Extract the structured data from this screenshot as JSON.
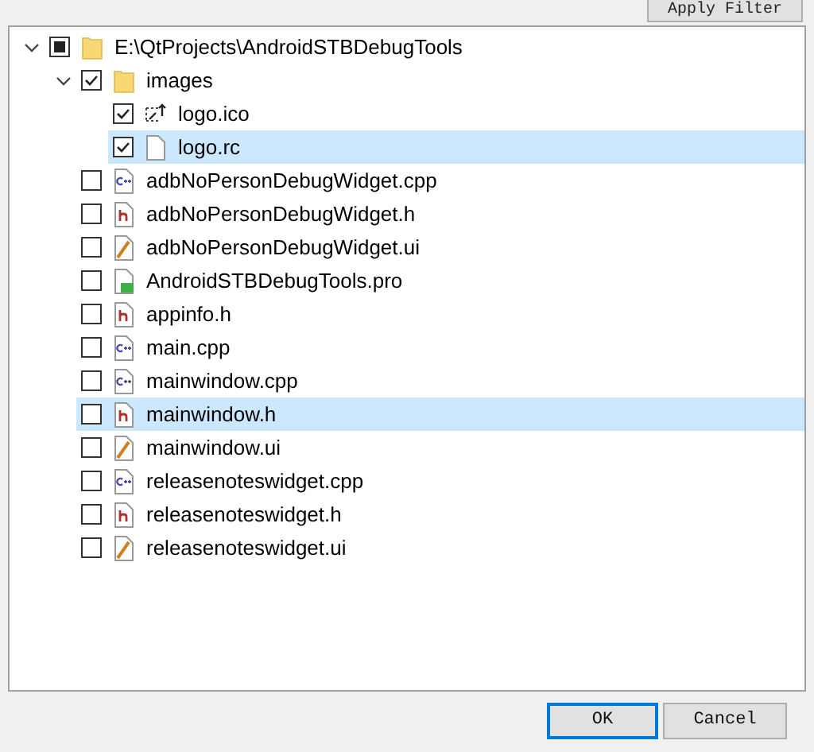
{
  "apply_filter_button": "Apply Filter",
  "tree": [
    {
      "label": "E:\\QtProjects\\AndroidSTBDebugTools",
      "kind": "folder",
      "partial": true,
      "expanded": true,
      "selected": false,
      "children": [
        {
          "label": "images",
          "kind": "folder",
          "checked": true,
          "expanded": true,
          "selected": false,
          "children": [
            {
              "label": "logo.ico",
              "kind": "image",
              "checked": true,
              "selected": false
            },
            {
              "label": "logo.rc",
              "kind": "file",
              "checked": true,
              "selected": true
            }
          ]
        },
        {
          "label": "adbNoPersonDebugWidget.cpp",
          "kind": "cpp",
          "checked": false,
          "selected": false
        },
        {
          "label": "adbNoPersonDebugWidget.h",
          "kind": "h",
          "checked": false,
          "selected": false
        },
        {
          "label": "adbNoPersonDebugWidget.ui",
          "kind": "ui",
          "checked": false,
          "selected": false
        },
        {
          "label": "AndroidSTBDebugTools.pro",
          "kind": "pro",
          "checked": false,
          "selected": false
        },
        {
          "label": "appinfo.h",
          "kind": "h",
          "checked": false,
          "selected": false
        },
        {
          "label": "main.cpp",
          "kind": "cpp",
          "checked": false,
          "selected": false
        },
        {
          "label": "mainwindow.cpp",
          "kind": "cpp",
          "checked": false,
          "selected": false
        },
        {
          "label": "mainwindow.h",
          "kind": "h",
          "checked": false,
          "selected": true
        },
        {
          "label": "mainwindow.ui",
          "kind": "ui",
          "checked": false,
          "selected": false
        },
        {
          "label": "releasenoteswidget.cpp",
          "kind": "cpp",
          "checked": false,
          "selected": false
        },
        {
          "label": "releasenoteswidget.h",
          "kind": "h",
          "checked": false,
          "selected": false
        },
        {
          "label": "releasenoteswidget.ui",
          "kind": "ui",
          "checked": false,
          "selected": false
        }
      ]
    }
  ],
  "buttons": [
    {
      "label": "OK",
      "focused": true
    },
    {
      "label": "Cancel",
      "focused": false
    }
  ]
}
